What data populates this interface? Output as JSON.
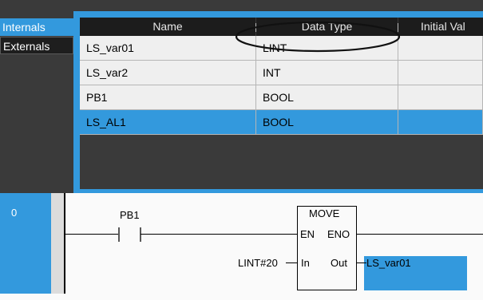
{
  "variable_tabs": [
    "Internals",
    "Externals"
  ],
  "table": {
    "columns": [
      "Name",
      "Data Type",
      "Initial Val"
    ],
    "rows": [
      {
        "name": "LS_var01",
        "data_type": "LINT",
        "initial": ""
      },
      {
        "name": "LS_var2",
        "data_type": "INT",
        "initial": ""
      },
      {
        "name": "PB1",
        "data_type": "BOOL",
        "initial": ""
      },
      {
        "name": "LS_AL1",
        "data_type": "BOOL",
        "initial": "",
        "selected": true
      }
    ]
  },
  "ladder": {
    "rung_number": "0",
    "contact_label": "PB1",
    "function_block": {
      "title": "MOVE",
      "pin_en": "EN",
      "pin_eno": "ENO",
      "pin_in": "In",
      "pin_out": "Out"
    },
    "in_value": "LINT#20",
    "out_variable": "LS_var01"
  },
  "colors": {
    "accent_blue": "#3399dd",
    "header_dark": "#1c1c1c",
    "panel_dark": "#3a3a3a"
  }
}
